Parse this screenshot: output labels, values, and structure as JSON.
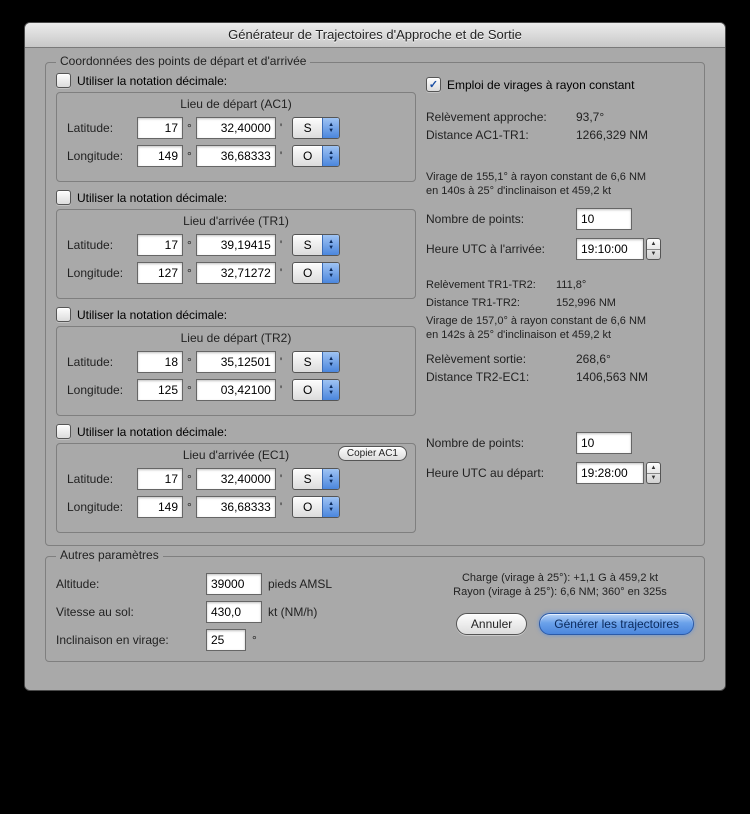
{
  "window": {
    "title": "Générateur de Trajectoires d'Approche et de Sortie"
  },
  "coords_legend": "Coordonnées des points de départ et d'arrivée",
  "decimal_label": "Utiliser la notation décimale:",
  "copy_ac1_label": "Copier AC1",
  "point_titles": {
    "ac1": "Lieu de départ (AC1)",
    "tr1": "Lieu d'arrivée (TR1)",
    "tr2": "Lieu de départ (TR2)",
    "ec1": "Lieu d'arrivée (EC1)"
  },
  "labels": {
    "lat": "Latitude:",
    "lon": "Longitude:",
    "npoints": "Nombre de points:",
    "utc_arr": "Heure UTC à l'arrivée:",
    "utc_dep": "Heure UTC au départ:",
    "rel_appr": "Relèvement approche:",
    "dist_ac1_tr1": "Distance AC1-TR1:",
    "rel_tr1_tr2": "Relèvement TR1-TR2:",
    "dist_tr1_tr2": "Distance TR1-TR2:",
    "rel_sortie": "Relèvement sortie:",
    "dist_tr2_ec1": "Distance TR2-EC1:",
    "rcturns": "Emploi de virages à rayon constant"
  },
  "ac1": {
    "lat_deg": "17",
    "lat_min": "32,40000",
    "lat_h": "S",
    "lon_deg": "149",
    "lon_min": "36,68333",
    "lon_h": "O"
  },
  "tr1": {
    "lat_deg": "17",
    "lat_min": "39,19415",
    "lat_h": "S",
    "lon_deg": "127",
    "lon_min": "32,71272",
    "lon_h": "O"
  },
  "tr2": {
    "lat_deg": "18",
    "lat_min": "35,12501",
    "lat_h": "S",
    "lon_deg": "125",
    "lon_min": "03,42100",
    "lon_h": "O"
  },
  "ec1": {
    "lat_deg": "17",
    "lat_min": "32,40000",
    "lat_h": "S",
    "lon_deg": "149",
    "lon_min": "36,68333",
    "lon_h": "O"
  },
  "right": {
    "appr_bearing": "93,7°",
    "dist_ac1_tr1": "1266,329 NM",
    "turn1_line1": "Virage de 155,1° à rayon constant de 6,6 NM",
    "turn1_line2": "en 140s à 25° d'inclinaison et 459,2 kt",
    "npoints1": "10",
    "utc_arr": "19:10:00",
    "rel_tr1_tr2": "111,8°",
    "dist_tr1_tr2": "152,996 NM",
    "turn2_line1": "Virage de 157,0° à rayon constant de 6,6 NM",
    "turn2_line2": "en 142s à 25° d'inclinaison et 459,2 kt",
    "rel_sortie": "268,6°",
    "dist_tr2_ec1": "1406,563 NM",
    "npoints2": "10",
    "utc_dep": "19:28:00"
  },
  "params_legend": "Autres paramètres",
  "params": {
    "alt_label": "Altitude:",
    "alt_val": "39000",
    "alt_unit": "pieds AMSL",
    "gs_label": "Vitesse au sol:",
    "gs_val": "430,0",
    "gs_unit": "kt (NM/h)",
    "bank_label": "Inclinaison en virage:",
    "bank_val": "25",
    "bank_unit": "°",
    "info1": "Charge (virage à 25°): +1,1 G à 459,2 kt",
    "info2": "Rayon (virage à 25°): 6,6 NM; 360° en 325s"
  },
  "buttons": {
    "cancel": "Annuler",
    "generate": "Générer les trajectoires"
  }
}
